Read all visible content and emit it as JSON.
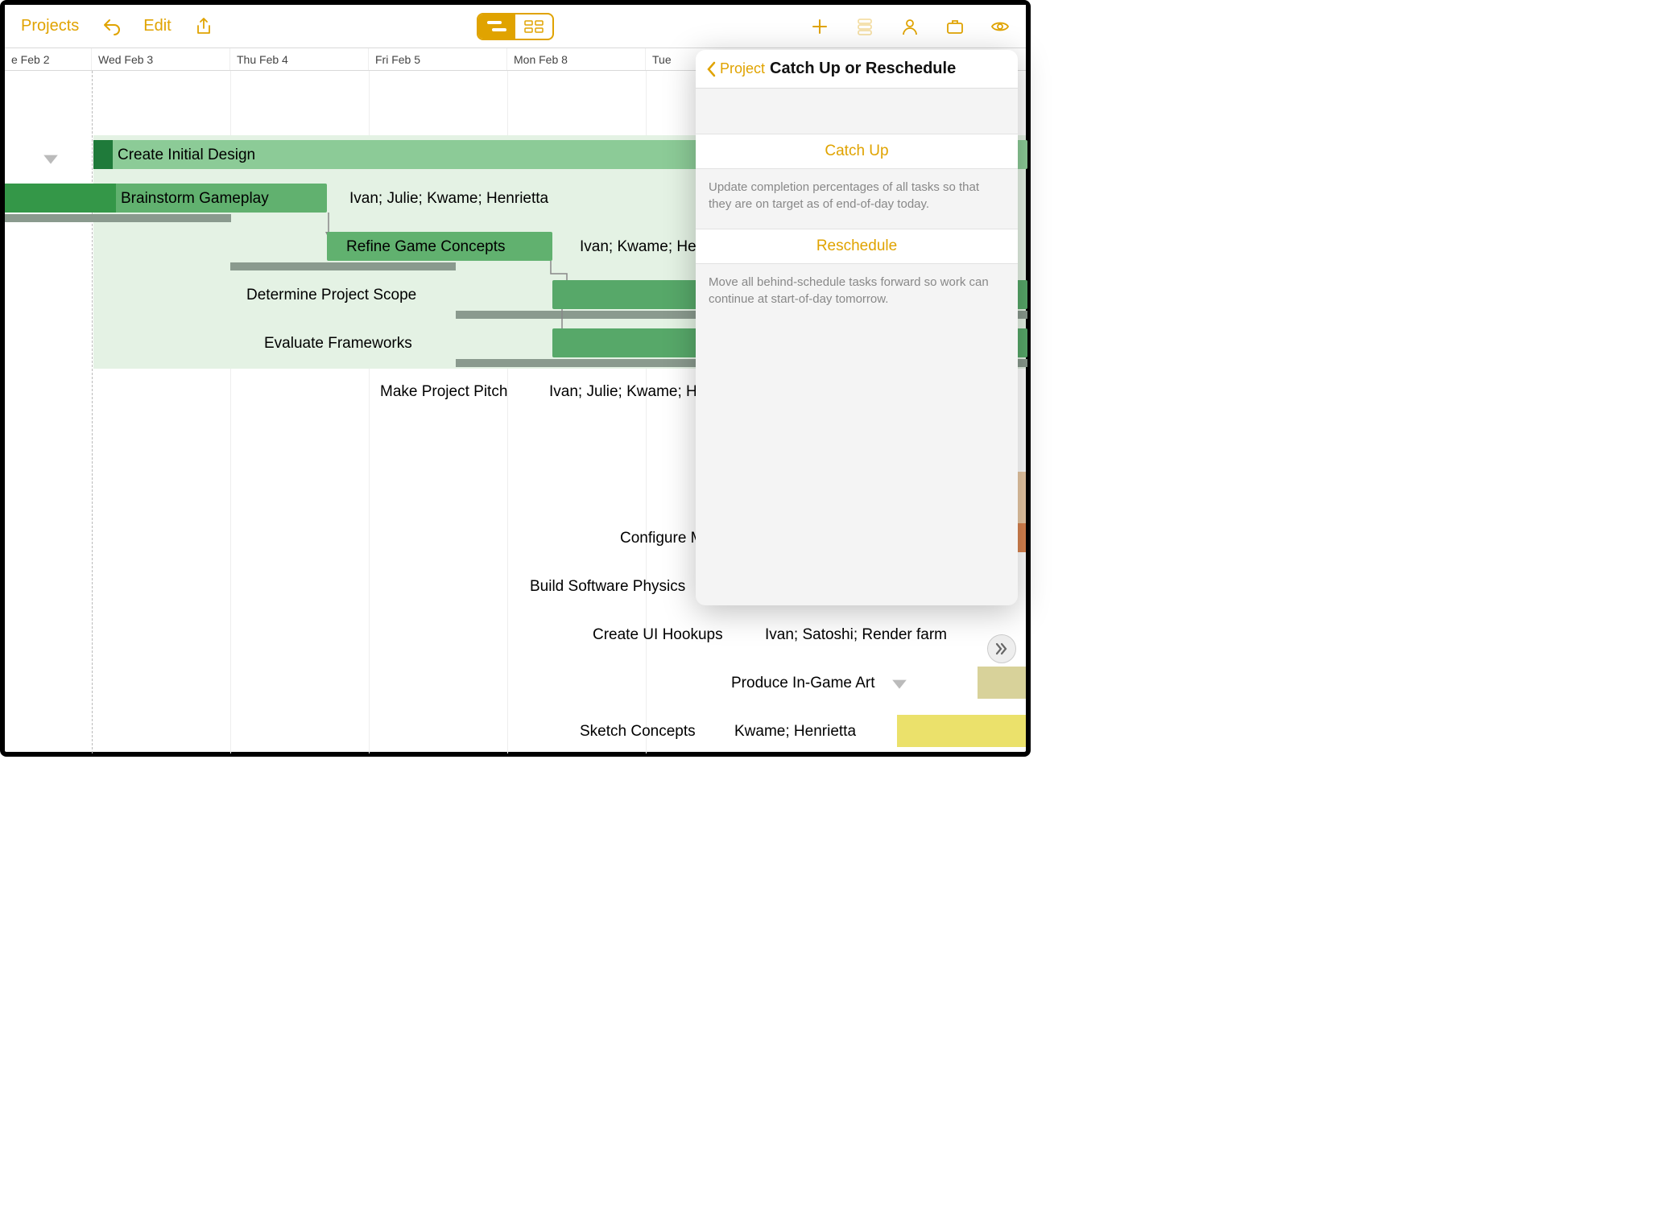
{
  "toolbar": {
    "projects": "Projects",
    "edit": "Edit"
  },
  "dates": [
    "e Feb 2",
    "Wed Feb 3",
    "Thu Feb 4",
    "Fri Feb 5",
    "Mon Feb 8",
    "Tue"
  ],
  "tasks": {
    "create_initial": "Create Initial Design",
    "brainstorm": "Brainstorm Gameplay",
    "brainstorm_assign": "Ivan; Julie; Kwame; Henrietta",
    "refine": "Refine Game Concepts",
    "refine_assign": "Ivan; Kwame; He",
    "determine": "Determine Project Scope",
    "evaluate": "Evaluate Frameworks",
    "pitch": "Make Project Pitch",
    "pitch_assign": "Ivan; Julie; Kwame; H",
    "configure": "Configure M",
    "physics": "Build Software Physics",
    "hookups": "Create UI Hookups",
    "hookups_assign": "Ivan; Satoshi; Render farm",
    "ingame": "Produce In-Game Art",
    "sketch": "Sketch Concepts",
    "sketch_assign": "Kwame; Henrietta"
  },
  "popover": {
    "back": "Project",
    "title": "Catch Up or Reschedule",
    "catchup": "Catch Up",
    "catchup_desc": "Update completion percentages of all tasks so that they are on target as of end-of-day today.",
    "reschedule": "Reschedule",
    "reschedule_desc": "Move all behind-schedule tasks forward so work can continue at start-of-day tomorrow."
  }
}
